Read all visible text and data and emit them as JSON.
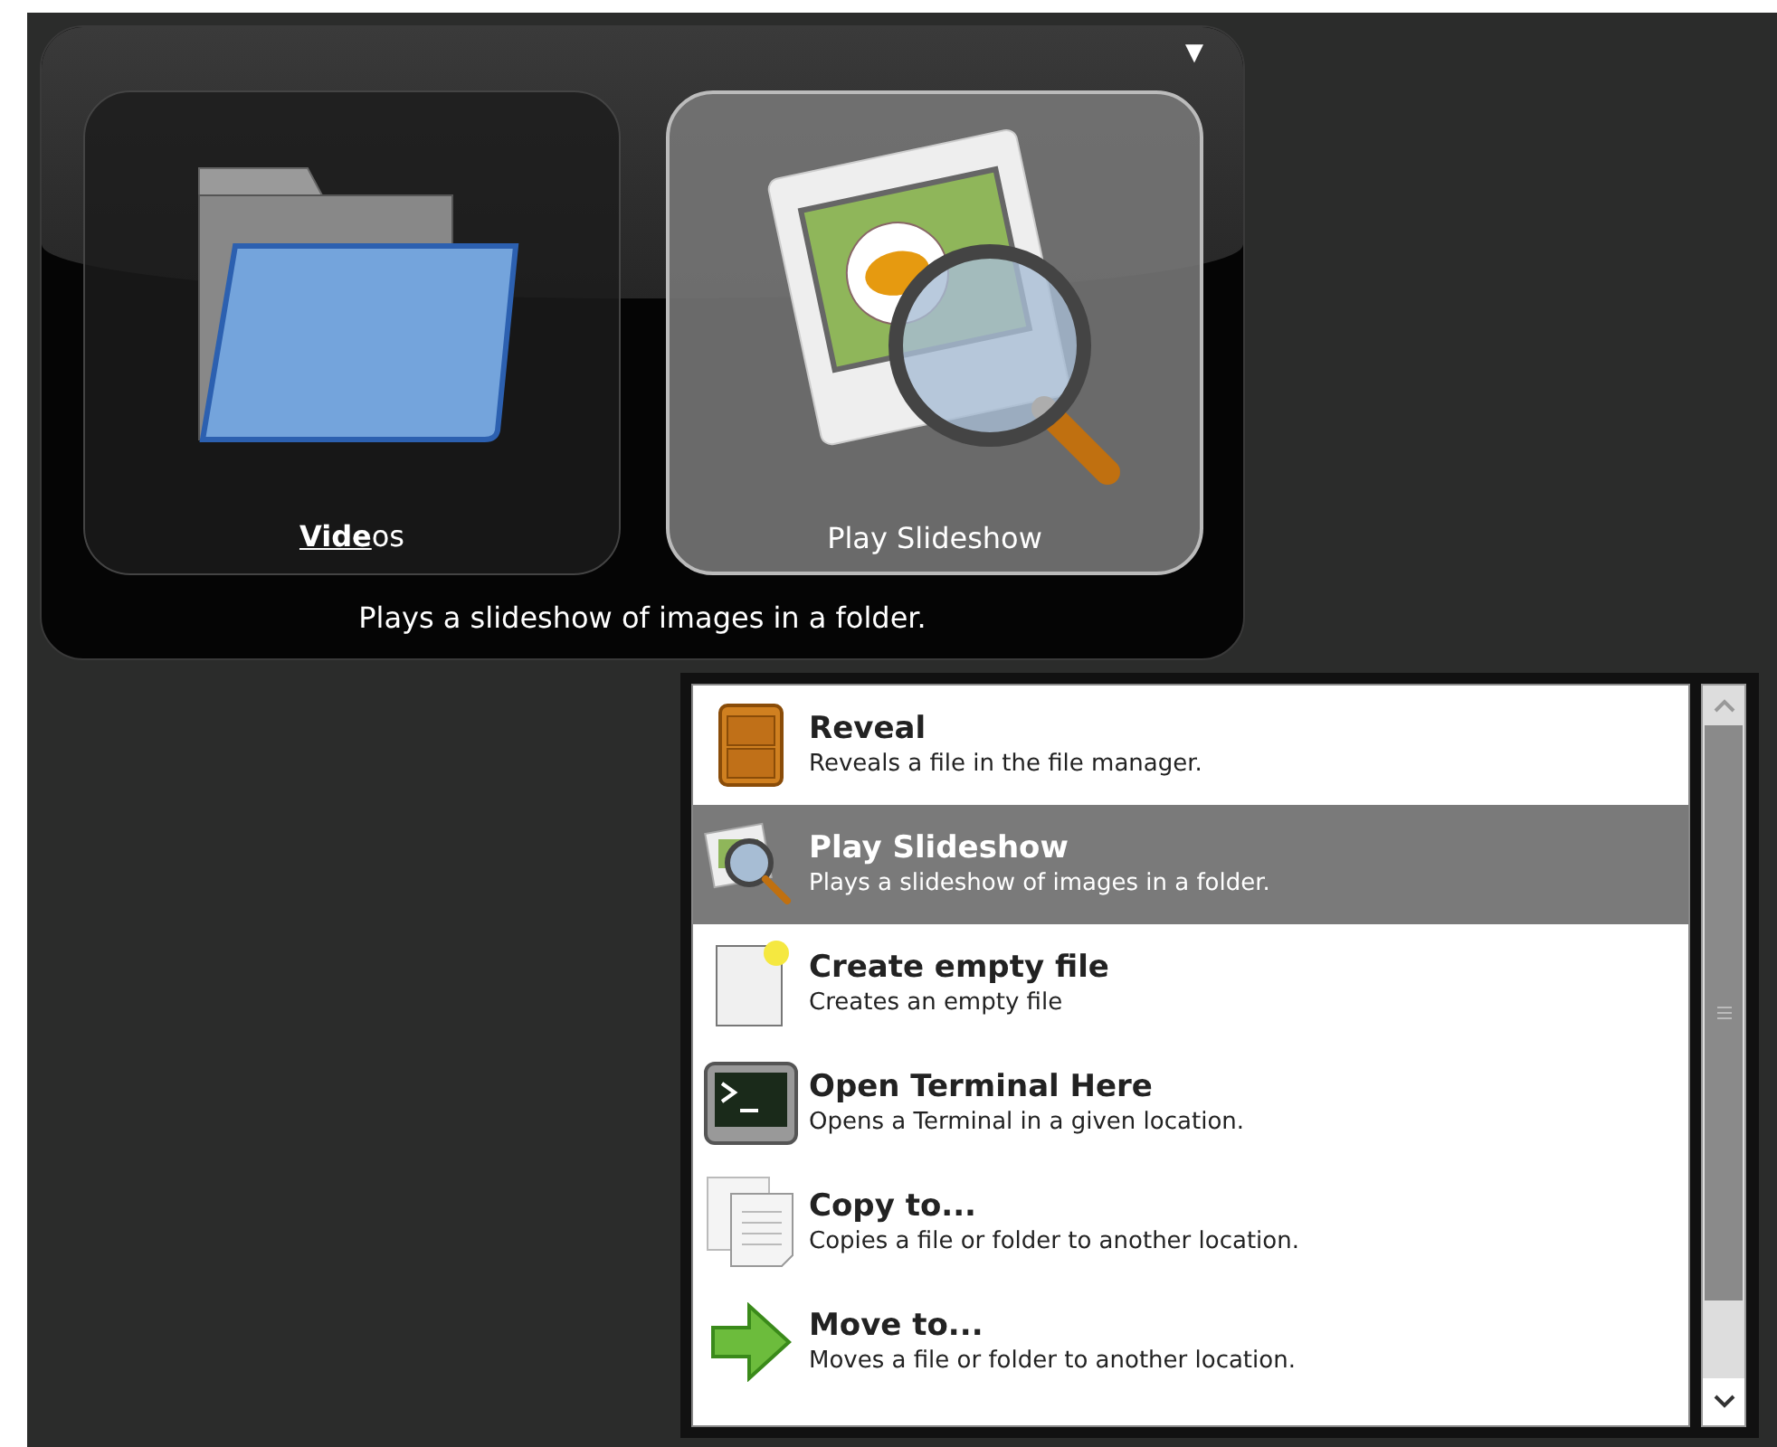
{
  "menu_button": {
    "glyph": "▼"
  },
  "tiles": [
    {
      "label": "**Vide**os",
      "selected": false
    },
    {
      "label": "Play Slideshow",
      "selected": true
    }
  ],
  "description": "Plays a slideshow of images in a folder.",
  "actions": [
    {
      "title": "Reveal",
      "subtitle": "Reveals a file in the file manager.",
      "selected": false
    },
    {
      "title": "Play Slideshow",
      "subtitle": "Plays a slideshow of images in a folder.",
      "selected": true
    },
    {
      "title": "Create empty file",
      "subtitle": "Creates an empty file",
      "selected": false
    },
    {
      "title": "Open Terminal Here",
      "subtitle": "Opens a Terminal in a given location.",
      "selected": false
    },
    {
      "title": "Copy to...",
      "subtitle": "Copies a file or folder to another location.",
      "selected": false
    },
    {
      "title": "Move to...",
      "subtitle": "Moves a file or folder to another location.",
      "selected": false
    }
  ]
}
